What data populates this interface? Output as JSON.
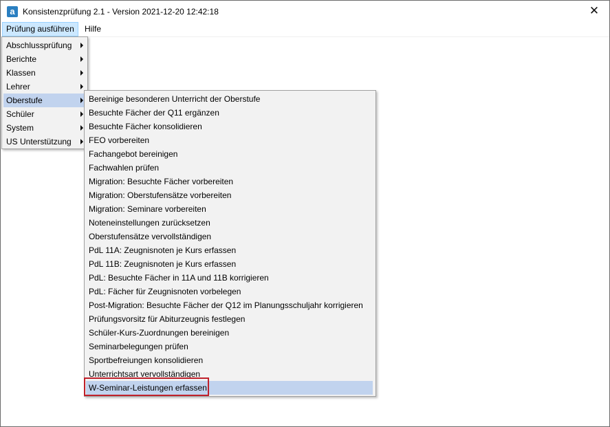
{
  "window": {
    "title": "Konsistenzprüfung 2.1 - Version 2021-12-20 12:42:18",
    "app_icon_letter": "a",
    "close_glyph": "✕"
  },
  "menubar": [
    {
      "label": "Prüfung ausführen",
      "open": true
    },
    {
      "label": "Hilfe",
      "open": false
    }
  ],
  "main_menu": {
    "items": [
      {
        "label": "Abschlussprüfung",
        "submenu": true
      },
      {
        "label": "Berichte",
        "submenu": true
      },
      {
        "label": "Klassen",
        "submenu": true
      },
      {
        "label": "Lehrer",
        "submenu": true
      },
      {
        "label": "Oberstufe",
        "submenu": true,
        "highlighted": true
      },
      {
        "label": "Schüler",
        "submenu": true
      },
      {
        "label": "System",
        "submenu": true
      },
      {
        "label": "US Unterstützung",
        "submenu": true
      }
    ]
  },
  "oberstufe_menu": {
    "items": [
      "Bereinige besonderen Unterricht der Oberstufe",
      "Besuchte Fächer der Q11 ergänzen",
      "Besuchte Fächer konsolidieren",
      "FEO vorbereiten",
      "Fachangebot bereinigen",
      "Fachwahlen prüfen",
      "Migration: Besuchte Fächer vorbereiten",
      "Migration: Oberstufensätze vorbereiten",
      "Migration: Seminare vorbereiten",
      "Noteneinstellungen zurücksetzen",
      "Oberstufensätze vervollständigen",
      "PdL 11A: Zeugnisnoten je Kurs erfassen",
      "PdL 11B: Zeugnisnoten je Kurs erfassen",
      "PdL: Besuchte Fächer in 11A und 11B korrigieren",
      "PdL: Fächer für Zeugnisnoten vorbelegen",
      "Post-Migration: Besuchte Fächer der Q12 im Planungsschuljahr korrigieren",
      "Prüfungsvorsitz für Abiturzeugnis festlegen",
      "Schüler-Kurs-Zuordnungen bereinigen",
      "Seminarbelegungen prüfen",
      "Sportbefreiungen konsolidieren",
      "Unterrichtsart vervollständigen",
      "W-Seminar-Leistungen erfassen"
    ],
    "highlighted_index": 21
  },
  "colors": {
    "highlight": "#c1d3ee",
    "annotation_red": "#c0202a",
    "menubar_open": "#cce8ff"
  }
}
